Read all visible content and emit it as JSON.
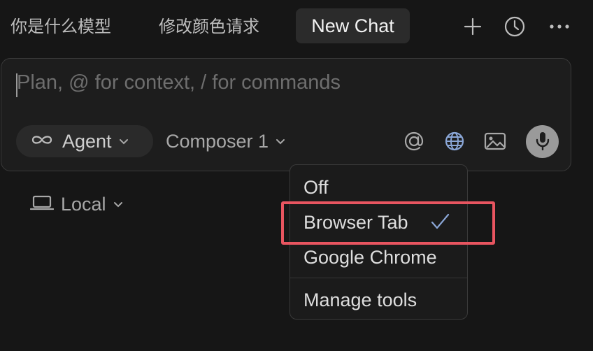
{
  "tabs": [
    {
      "label": "你是什么模型"
    },
    {
      "label": "修改颜色请求"
    },
    {
      "label": "New Chat"
    }
  ],
  "toolbar": {
    "new_chat_icon": "plus-icon",
    "history_icon": "clock-icon",
    "more_icon": "ellipsis-icon"
  },
  "composer": {
    "placeholder": "Plan, @ for context, / for commands",
    "mode_label": "Agent",
    "mode_icon": "infinity-icon",
    "model_label": "Composer 1",
    "icons": [
      "at-sign-icon",
      "globe-icon",
      "image-icon",
      "microphone-icon"
    ]
  },
  "environment": {
    "label": "Local",
    "icon": "laptop-icon"
  },
  "browser_menu": {
    "items": [
      {
        "label": "Off"
      },
      {
        "label": "Browser Tab",
        "selected": true
      },
      {
        "label": "Google Chrome"
      },
      {
        "label": "Manage tools"
      }
    ]
  },
  "colors": {
    "background": "#161616",
    "highlight": "#e85560",
    "check": "#8aa6d6"
  }
}
